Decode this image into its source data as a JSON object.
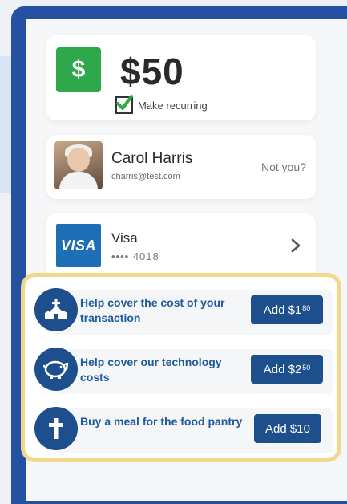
{
  "amount_card": {
    "dollar_icon": "dollar-sign-icon",
    "dollar_glyph": "$",
    "amount": "$50",
    "recurring_label": "Make recurring",
    "recurring_checked": true,
    "accent": "#2ea84a"
  },
  "user": {
    "name": "Carol Harris",
    "email": "charris@test.com",
    "not_you_label": "Not you?"
  },
  "payment": {
    "brand_logo_text": "VISA",
    "brand": "Visa",
    "masked_number": "•••• 4018",
    "chevron_icon": "chevron-right-icon"
  },
  "addons": {
    "border_color": "#f2d88c",
    "items": [
      {
        "icon": "church-icon",
        "text": "Help cover the cost of your transaction",
        "button_prefix": "Add $1",
        "button_cents": "80"
      },
      {
        "icon": "piggy-bank-icon",
        "text": "Help cover our technology costs",
        "button_prefix": "Add $2",
        "button_cents": "50"
      },
      {
        "icon": "cross-icon",
        "text": "Buy a meal for the food pantry",
        "button_prefix": "Add $10",
        "button_cents": ""
      }
    ]
  },
  "colors": {
    "frame": "#2551a3",
    "button": "#1d4f8c",
    "addon_text": "#1d5a99"
  }
}
